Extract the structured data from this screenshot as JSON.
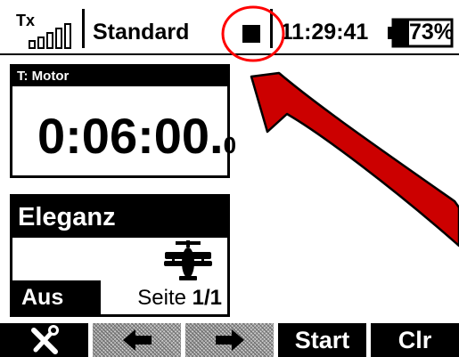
{
  "status_bar": {
    "tx_label": "Tx",
    "tx_signal_icon": "signal-strength-icon",
    "profile": "Standard",
    "stop_icon": "stop-icon",
    "time": "11:29:41",
    "battery_percent": "73%",
    "battery_level": 0.73
  },
  "timer": {
    "title": "T: Motor",
    "value": "0:06:00.",
    "decimal": "0"
  },
  "model": {
    "name": "Eleganz",
    "icon": "airplane-icon",
    "mode": "Aus",
    "page_label": "Seite",
    "page_value": "1/1"
  },
  "softkeys": {
    "tools_icon": "tools-icon",
    "left_icon": "arrow-left-icon",
    "right_icon": "arrow-right-icon",
    "start": "Start",
    "clear": "Clr"
  },
  "annotation": {
    "circle_color": "#ff0000",
    "arrow_color": "#cc0000"
  }
}
